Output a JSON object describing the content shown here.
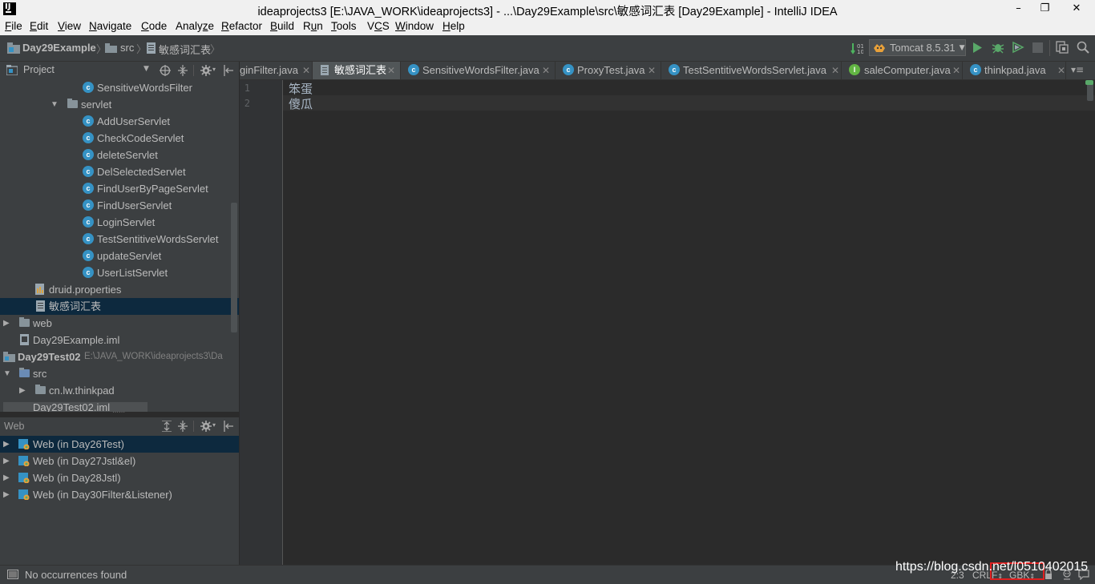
{
  "window": {
    "title": "ideaprojects3 [E:\\JAVA_WORK\\ideaprojects3] - ...\\Day29Example\\src\\敏感词汇表 [Day29Example] - IntelliJ IDEA",
    "minimize": "–",
    "restore": "❐",
    "close": "✕"
  },
  "menu": [
    {
      "label": "File",
      "u": "F",
      "rest": "ile"
    },
    {
      "label": "Edit",
      "u": "E",
      "rest": "dit"
    },
    {
      "label": "View",
      "u": "V",
      "rest": "iew"
    },
    {
      "label": "Navigate",
      "u": "N",
      "rest": "avigate"
    },
    {
      "label": "Code",
      "u": "C",
      "rest": "ode"
    },
    {
      "label": "Analyze",
      "pre": "Analy",
      "u": "z",
      "rest": "e"
    },
    {
      "label": "Refactor",
      "u": "R",
      "rest": "efactor"
    },
    {
      "label": "Build",
      "u": "B",
      "rest": "uild"
    },
    {
      "label": "Run",
      "pre": "R",
      "u": "u",
      "rest": "n"
    },
    {
      "label": "Tools",
      "u": "T",
      "rest": "ools"
    },
    {
      "label": "VCS",
      "pre": "V",
      "u": "C",
      "rest": "S"
    },
    {
      "label": "Window",
      "u": "W",
      "rest": "indow"
    },
    {
      "label": "Help",
      "u": "H",
      "rest": "elp"
    }
  ],
  "breadcrumb": {
    "project": "Day29Example",
    "folder": "src",
    "file": "敏感词汇表"
  },
  "run_config": {
    "label": "Tomcat 8.5.31"
  },
  "project_panel": {
    "title": "Project",
    "tree": [
      {
        "label": "SensitiveWordsFilter",
        "kind": "class"
      },
      {
        "label": "servlet",
        "kind": "folder",
        "expanded": true
      },
      {
        "label": "AddUserServlet",
        "kind": "class"
      },
      {
        "label": "CheckCodeServlet",
        "kind": "class"
      },
      {
        "label": "deleteServlet",
        "kind": "class"
      },
      {
        "label": "DelSelectedServlet",
        "kind": "class"
      },
      {
        "label": "FindUserByPageServlet",
        "kind": "class"
      },
      {
        "label": "FindUserServlet",
        "kind": "class"
      },
      {
        "label": "LoginServlet",
        "kind": "class"
      },
      {
        "label": "TestSentitiveWordsServlet",
        "kind": "class"
      },
      {
        "label": "updateServlet",
        "kind": "class"
      },
      {
        "label": "UserListServlet",
        "kind": "class"
      },
      {
        "label": "druid.properties",
        "kind": "file"
      },
      {
        "label": "敏感词汇表",
        "kind": "file",
        "selected": true
      },
      {
        "label": "web",
        "kind": "folder",
        "expanded": false
      },
      {
        "label": "Day29Example.iml",
        "kind": "file"
      },
      {
        "label": "Day29Test02",
        "path": "E:\\JAVA_WORK\\ideaprojects3\\Da",
        "kind": "module"
      },
      {
        "label": "src",
        "kind": "folder",
        "expanded": true
      },
      {
        "label": "cn.lw.thinkpad",
        "kind": "package"
      },
      {
        "label": "Day29Test02.iml",
        "kind": "file"
      }
    ]
  },
  "web_panel": {
    "title": "Web",
    "items": [
      {
        "label": "Web (in Day26Test)",
        "selected": true
      },
      {
        "label": "Web (in Day27Jstl&el)"
      },
      {
        "label": "Web (in Day28Jstl)"
      },
      {
        "label": "Web (in Day30Filter&Listener)"
      }
    ]
  },
  "tabs": [
    {
      "label": "ginFilter.java",
      "icon": "none"
    },
    {
      "label": "敏感词汇表",
      "icon": "file",
      "active": true
    },
    {
      "label": "SensitiveWordsFilter.java",
      "icon": "class"
    },
    {
      "label": "ProxyTest.java",
      "icon": "class"
    },
    {
      "label": "TestSentitiveWordsServlet.java",
      "icon": "class"
    },
    {
      "label": "saleComputer.java",
      "icon": "interface"
    },
    {
      "label": "thinkpad.java",
      "icon": "class"
    }
  ],
  "tab_overflow": "▾≡",
  "editor": {
    "lines": [
      {
        "no": "1",
        "text": "笨蛋"
      },
      {
        "no": "2",
        "text": "傻瓜"
      }
    ]
  },
  "status": {
    "message": "No occurrences found",
    "position": "2:3",
    "line_sep": "CRLF",
    "encoding": "GBK"
  },
  "watermark": "https://blog.csdn.net/l0510402015"
}
